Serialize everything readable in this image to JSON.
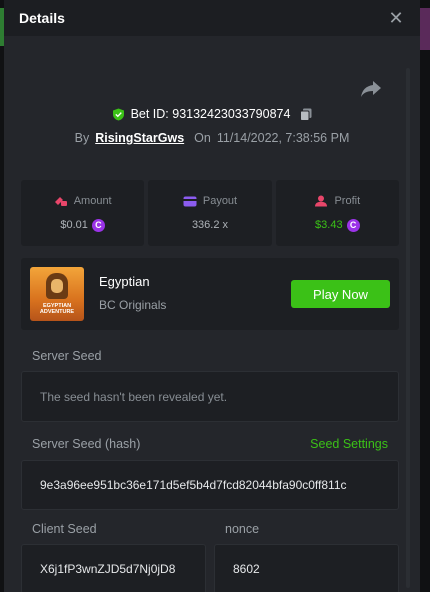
{
  "header": {
    "title": "Details",
    "close_glyph": "✕"
  },
  "bet": {
    "id_label": "Bet ID: 93132423033790874",
    "by_label": "By",
    "username": "RisingStarGws",
    "on_label": "On",
    "datetime": "11/14/2022, 7:38:56 PM"
  },
  "stats": {
    "amount": {
      "label": "Amount",
      "value": "$0.01",
      "icon": "bet-chips-icon"
    },
    "payout": {
      "label": "Payout",
      "value": "336.2 x",
      "icon": "wallet-card-icon"
    },
    "profit": {
      "label": "Profit",
      "value": "$3.43",
      "icon": "profit-user-icon"
    }
  },
  "coin_symbol": "C",
  "game": {
    "name": "Egyptian",
    "provider": "BC Originals",
    "thumb_text": "EGYPTIAN ADVENTURE",
    "play_label": "Play Now"
  },
  "fairness": {
    "server_seed_label": "Server Seed",
    "server_seed_value": "The seed hasn't been revealed yet.",
    "server_hash_label": "Server Seed (hash)",
    "seed_settings_label": "Seed Settings",
    "server_hash_value": "9e3a96ee951bc36e171d5ef5b4d7fcd82044bfa90c0ff811c",
    "client_seed_label": "Client Seed",
    "client_seed_value": "X6j1fP3wnZJD5d7Nj0jD8",
    "nonce_label": "nonce",
    "nonce_value": "8602"
  },
  "colors": {
    "accent_green": "#3bc117",
    "coin_purple": "#9b33e8",
    "panel": "#24262b",
    "card": "#1d1f23"
  }
}
